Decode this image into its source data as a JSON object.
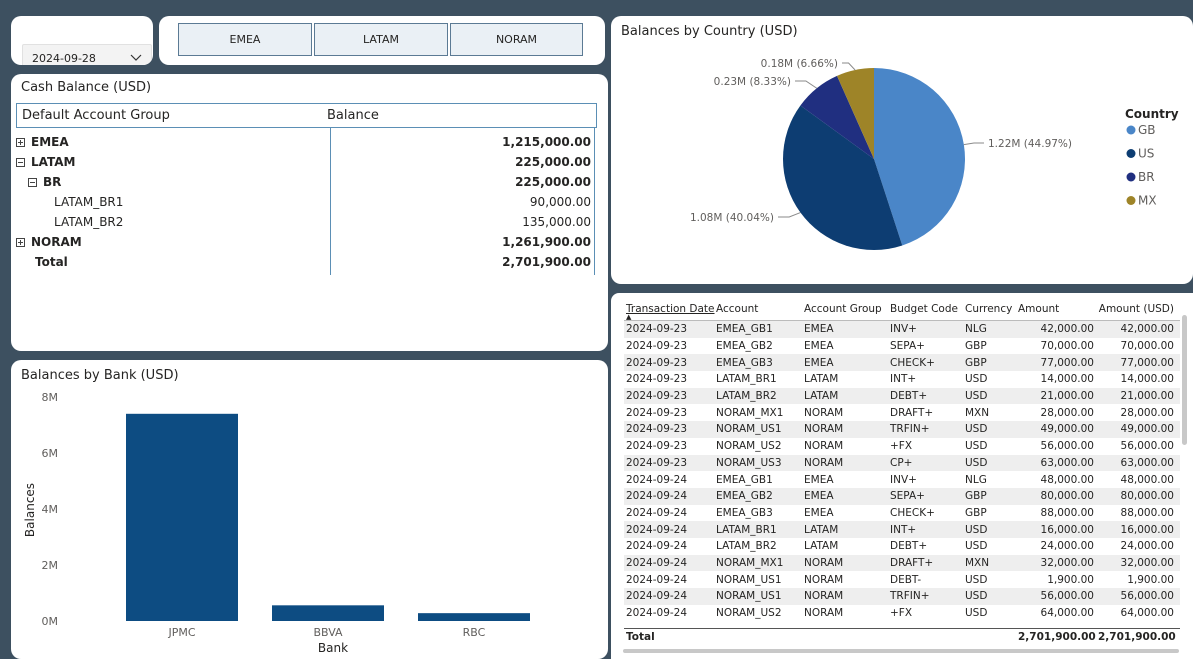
{
  "date_slicer": {
    "value": "2024-09-28"
  },
  "region_buttons": [
    {
      "label": "EMEA"
    },
    {
      "label": "LATAM"
    },
    {
      "label": "NORAM"
    }
  ],
  "cash_balance": {
    "title": "Cash Balance (USD)",
    "headers": [
      "Default Account Group",
      "Balance"
    ],
    "rows": [
      {
        "label": "EMEA",
        "value": "1,215,000.00",
        "bold": true,
        "expand": "plus",
        "indent": 0
      },
      {
        "label": "LATAM",
        "value": "225,000.00",
        "bold": true,
        "expand": "minus",
        "indent": 0
      },
      {
        "label": "BR",
        "value": "225,000.00",
        "bold": true,
        "expand": "minus",
        "indent": 1
      },
      {
        "label": "LATAM_BR1",
        "value": "90,000.00",
        "bold": false,
        "expand": "",
        "indent": 2
      },
      {
        "label": "LATAM_BR2",
        "value": "135,000.00",
        "bold": false,
        "expand": "",
        "indent": 2
      },
      {
        "label": "NORAM",
        "value": "1,261,900.00",
        "bold": true,
        "expand": "plus",
        "indent": 0
      },
      {
        "label": "Total",
        "value": "2,701,900.00",
        "bold": true,
        "expand": "",
        "indent": 0
      }
    ]
  },
  "bank_chart_title": "Balances by Bank (USD)",
  "country_chart_title": "Balances by Country (USD)",
  "chart_data": [
    {
      "type": "bar",
      "title": "Balances by Bank (USD)",
      "categories": [
        "JPMC",
        "BBVA",
        "RBC"
      ],
      "values": [
        7400000,
        560000,
        280000
      ],
      "xlabel": "Bank",
      "ylabel": "Balances",
      "yticks": [
        "0M",
        "2M",
        "4M",
        "6M",
        "8M"
      ],
      "ylim": [
        0,
        8000000
      ],
      "color": "#0d4c82"
    },
    {
      "type": "pie",
      "title": "Balances by Country (USD)",
      "legend_title": "Country",
      "legend_position": "right",
      "slices": [
        {
          "name": "GB",
          "value": 1.22,
          "percent": 44.97,
          "label": "1.22M (44.97%)",
          "color": "#4a86c8"
        },
        {
          "name": "US",
          "value": 1.08,
          "percent": 40.04,
          "label": "1.08M (40.04%)",
          "color": "#0d3d72"
        },
        {
          "name": "BR",
          "value": 0.23,
          "percent": 8.33,
          "label": "0.23M (8.33%)",
          "color": "#202f80"
        },
        {
          "name": "MX",
          "value": 0.18,
          "percent": 6.66,
          "label": "0.18M (6.66%)",
          "color": "#9e8428"
        }
      ]
    }
  ],
  "transactions": {
    "headers": [
      "Transaction Date",
      "Account",
      "Account Group",
      "Budget Code",
      "Currency",
      "Amount",
      "Amount (USD)"
    ],
    "rows": [
      [
        "2024-09-23",
        "EMEA_GB1",
        "EMEA",
        "INV+",
        "NLG",
        "42,000.00",
        "42,000.00"
      ],
      [
        "2024-09-23",
        "EMEA_GB2",
        "EMEA",
        "SEPA+",
        "GBP",
        "70,000.00",
        "70,000.00"
      ],
      [
        "2024-09-23",
        "EMEA_GB3",
        "EMEA",
        "CHECK+",
        "GBP",
        "77,000.00",
        "77,000.00"
      ],
      [
        "2024-09-23",
        "LATAM_BR1",
        "LATAM",
        "INT+",
        "USD",
        "14,000.00",
        "14,000.00"
      ],
      [
        "2024-09-23",
        "LATAM_BR2",
        "LATAM",
        "DEBT+",
        "USD",
        "21,000.00",
        "21,000.00"
      ],
      [
        "2024-09-23",
        "NORAM_MX1",
        "NORAM",
        "DRAFT+",
        "MXN",
        "28,000.00",
        "28,000.00"
      ],
      [
        "2024-09-23",
        "NORAM_US1",
        "NORAM",
        "TRFIN+",
        "USD",
        "49,000.00",
        "49,000.00"
      ],
      [
        "2024-09-23",
        "NORAM_US2",
        "NORAM",
        "+FX",
        "USD",
        "56,000.00",
        "56,000.00"
      ],
      [
        "2024-09-23",
        "NORAM_US3",
        "NORAM",
        "CP+",
        "USD",
        "63,000.00",
        "63,000.00"
      ],
      [
        "2024-09-24",
        "EMEA_GB1",
        "EMEA",
        "INV+",
        "NLG",
        "48,000.00",
        "48,000.00"
      ],
      [
        "2024-09-24",
        "EMEA_GB2",
        "EMEA",
        "SEPA+",
        "GBP",
        "80,000.00",
        "80,000.00"
      ],
      [
        "2024-09-24",
        "EMEA_GB3",
        "EMEA",
        "CHECK+",
        "GBP",
        "88,000.00",
        "88,000.00"
      ],
      [
        "2024-09-24",
        "LATAM_BR1",
        "LATAM",
        "INT+",
        "USD",
        "16,000.00",
        "16,000.00"
      ],
      [
        "2024-09-24",
        "LATAM_BR2",
        "LATAM",
        "DEBT+",
        "USD",
        "24,000.00",
        "24,000.00"
      ],
      [
        "2024-09-24",
        "NORAM_MX1",
        "NORAM",
        "DRAFT+",
        "MXN",
        "32,000.00",
        "32,000.00"
      ],
      [
        "2024-09-24",
        "NORAM_US1",
        "NORAM",
        "DEBT-",
        "USD",
        "1,900.00",
        "1,900.00"
      ],
      [
        "2024-09-24",
        "NORAM_US1",
        "NORAM",
        "TRFIN+",
        "USD",
        "56,000.00",
        "56,000.00"
      ],
      [
        "2024-09-24",
        "NORAM_US2",
        "NORAM",
        "+FX",
        "USD",
        "64,000.00",
        "64,000.00"
      ]
    ],
    "total_label": "Total",
    "total_amount": "2,701,900.00",
    "total_usd": "2,701,900.00"
  }
}
